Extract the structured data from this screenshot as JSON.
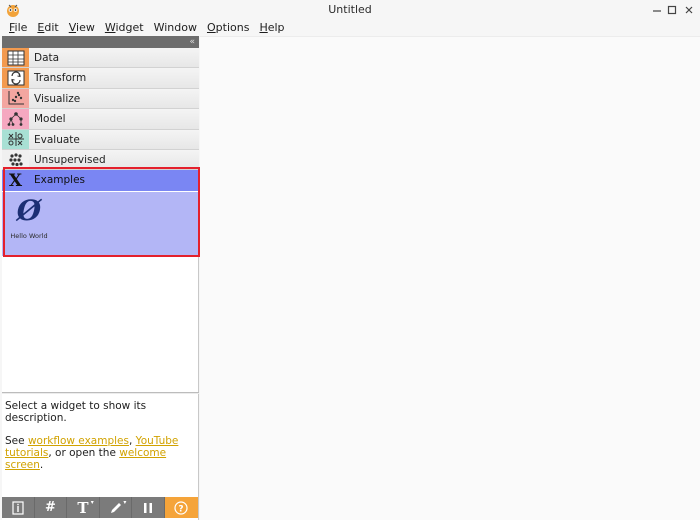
{
  "window": {
    "title": "Untitled"
  },
  "menubar": [
    {
      "mnemonic": "F",
      "rest": "ile"
    },
    {
      "mnemonic": "E",
      "rest": "dit"
    },
    {
      "mnemonic": "V",
      "rest": "iew"
    },
    {
      "mnemonic": "W",
      "rest": "idget"
    },
    {
      "mnemonic": "",
      "rest": "Window"
    },
    {
      "mnemonic": "O",
      "rest": "ptions"
    },
    {
      "mnemonic": "H",
      "rest": "elp"
    }
  ],
  "categories": [
    {
      "label": "Data",
      "icon": "data-table-icon",
      "color": "#f39a4f"
    },
    {
      "label": "Transform",
      "icon": "transform-icon",
      "color": "#f39a4f"
    },
    {
      "label": "Visualize",
      "icon": "scatter-icon",
      "color": "#f3a6a0"
    },
    {
      "label": "Model",
      "icon": "tree-icon",
      "color": "#f5a8c0"
    },
    {
      "label": "Evaluate",
      "icon": "evaluate-icon",
      "color": "#a8e0d4"
    },
    {
      "label": "Unsupervised",
      "icon": "cluster-icon",
      "color": "#f0f0f0"
    },
    {
      "label": "Examples",
      "icon": "x-icon",
      "color": "#7a86f3"
    }
  ],
  "examples": {
    "widgets": [
      {
        "label": "Hello World",
        "icon": "empty-set-icon",
        "glyph": "Ø"
      }
    ]
  },
  "description": {
    "line1": "Select a widget to show its description.",
    "see": "See ",
    "link_workflow": "workflow examples",
    "comma": ", ",
    "link_youtube": "YouTube tutorials",
    "or_open": ", or open the ",
    "link_welcome": "welcome screen",
    "period": "."
  },
  "toolbar": [
    {
      "name": "info-button",
      "icon": "info-icon"
    },
    {
      "name": "grid-button",
      "icon": "hash-icon"
    },
    {
      "name": "text-annotation-button",
      "icon": "text-icon"
    },
    {
      "name": "arrow-annotation-button",
      "icon": "pen-icon"
    },
    {
      "name": "pause-button",
      "icon": "pause-icon"
    },
    {
      "name": "help-button",
      "icon": "question-icon"
    }
  ],
  "colors": {
    "accent": "#f5a43a",
    "highlight": "#e4202c",
    "examples_selected": "#7a86f3",
    "examples_panel": "#b3b6f6",
    "link": "#d1a200"
  }
}
